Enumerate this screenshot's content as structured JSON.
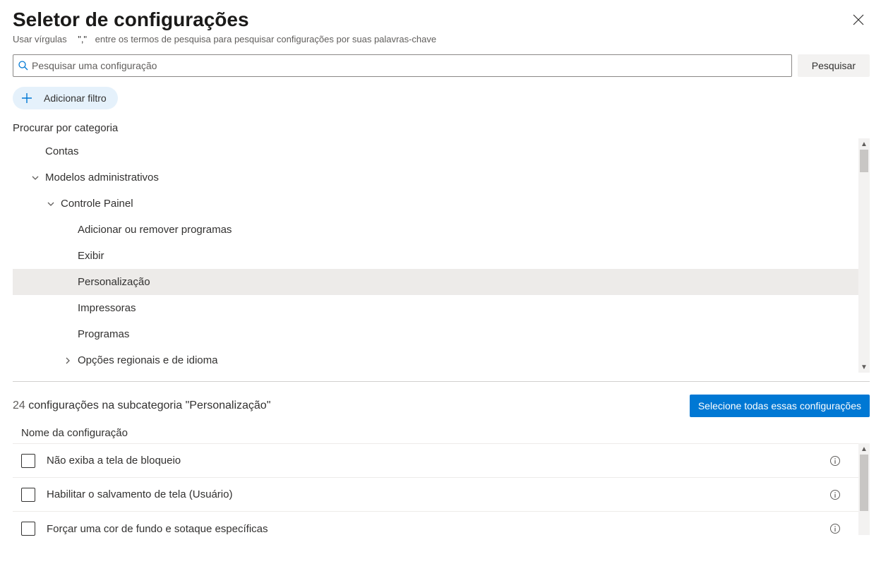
{
  "header": {
    "title": "Seletor de configurações",
    "hint_prefix": "Usar vírgulas",
    "hint_comma": "\",\"",
    "hint_suffix": "entre os termos de pesquisa para pesquisar configurações por suas palavras-chave"
  },
  "search": {
    "placeholder": "Pesquisar uma configuração",
    "button": "Pesquisar"
  },
  "filter": {
    "add_label": "Adicionar filtro"
  },
  "browse": {
    "label": "Procurar por categoria",
    "tree": {
      "accounts": "Contas",
      "admin_templates": "Modelos administrativos",
      "control_panel": "Controle  Painel",
      "add_remove_programs": "Adicionar ou remover programas",
      "display": "Exibir",
      "personalization": "Personalização",
      "printers": "Impressoras",
      "programs": "Programas",
      "regional_language": "Opções regionais e de idioma"
    }
  },
  "results": {
    "count": "24",
    "count_suffix": "configurações na subcategoria \"Personalização\"",
    "select_all": "Selecione todas essas configurações",
    "column_header": "Nome da configuração",
    "items": [
      {
        "name": "Não exiba a tela de bloqueio"
      },
      {
        "name": "Habilitar o salvamento de tela (Usuário)"
      },
      {
        "name": "Forçar uma cor de fundo e sotaque específicas"
      }
    ]
  }
}
